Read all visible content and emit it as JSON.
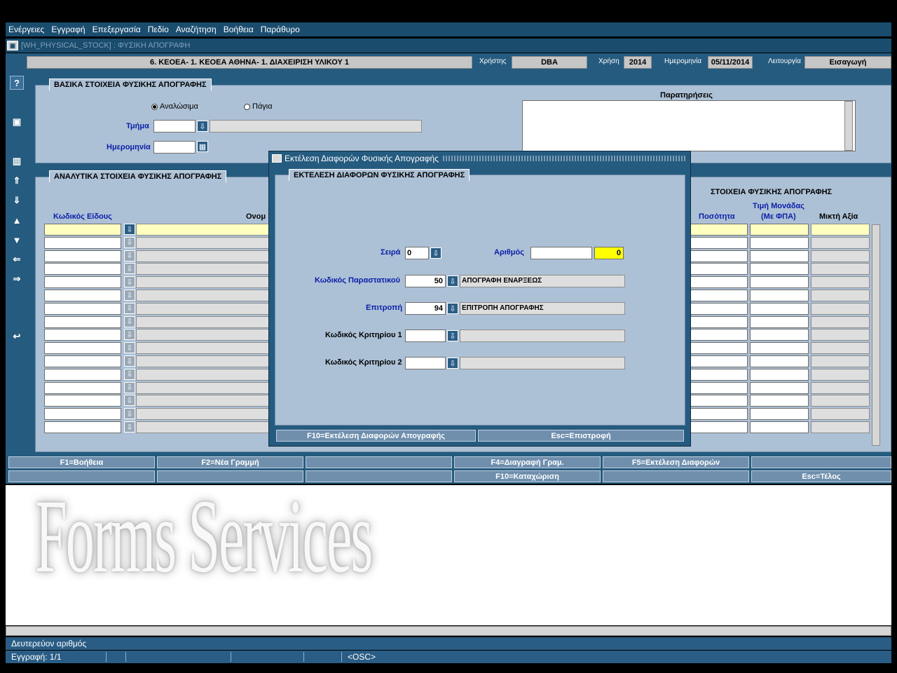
{
  "menu": [
    "Ενέργειες",
    "Εγγραφή",
    "Επεξεργασία",
    "Πεδίο",
    "Αναζήτηση",
    "Βοήθεια",
    "Παράθυρο"
  ],
  "window_title": "[WH_PHYSICAL_STOCK] : ΦΥΣΙΚΗ ΑΠΟΓΡΑΦΗ",
  "infobar": {
    "org": "6. ΚΕΟΕΑ- 1. ΚΕΟΕΑ ΑΘΗΝΑ- 1. ΔΙΑΧΕΙΡΙΣΗ ΥΛΙΚΟΥ 1",
    "user_label": "Χρήστης",
    "user": "DBA",
    "year_label": "Χρήση",
    "year": "2014",
    "date_label": "Ημερομηνία",
    "date": "05/11/2014",
    "mode_label": "Λειτουργία",
    "mode": "Εισαγωγή"
  },
  "basic": {
    "title": "ΒΑΣΙΚΑ ΣΤΟΙΧΕΙΑ ΦΥΣΙΚΗΣ ΑΠΟΓΡΑΦΗΣ",
    "radio1": "Αναλώσιμα",
    "radio2": "Πάγια",
    "dept_label": "Τμήμα",
    "date_label": "Ημερομηνία",
    "remarks_label": "Παρατηρήσεις"
  },
  "detail": {
    "title": "ΑΝΑΛΥΤΙΚΑ ΣΤΟΙΧΕΙΑ ΦΥΣΙΚΗΣ ΑΠΟΓΡΑΦΗΣ",
    "col_code": "Κωδικός Είδους",
    "col_name": "Ονομ",
    "group_title": "ΣΤΟΙΧΕΙΑ ΦΥΣΙΚΗΣ ΑΠΟΓΡΑΦΗΣ",
    "col_qty": "Ποσότητα",
    "col_price_line1": "Τιμή Μονάδας",
    "col_price_line2": "(Με ΦΠΑ)",
    "col_gross": "Μικτή Αξία"
  },
  "dialog": {
    "title": "Εκτέλεση Διαφορών Φυσικής Απογραφής",
    "panel_title": "ΕΚΤΕΛΕΣΗ ΔΙΑΦΟΡΩΝ ΦΥΣΙΚΗΣ ΑΠΟΓΡΑΦΗΣ",
    "series_label": "Σειρά",
    "series_value": "0",
    "number_label": "Αριθμός",
    "number_value": "0",
    "doc_label": "Κωδικός Παραστατικού",
    "doc_code": "50",
    "doc_name": "ΑΠΟΓΡΑΦΗ ΕΝΑΡΞΕΩΣ",
    "committee_label": "Επιτροπή",
    "committee_code": "94",
    "committee_name": "ΕΠΙΤΡΟΠΗ ΑΠΟΓΡΑΦΗΣ",
    "crit1_label": "Κωδικός Κριτηρίου 1",
    "crit2_label": "Κωδικός Κριτηρίου 2",
    "btn_run": "F10=Εκτέλεση Διαφορών Απογραφής",
    "btn_back": "Esc=Επιστροφή"
  },
  "fkeys_row1": [
    "F1=Βοήθεια",
    "F2=Νέα Γραμμή",
    "",
    "F4=Διαγραφή Γραμ.",
    "F5=Εκτέλεση Διαφορών",
    ""
  ],
  "fkeys_row2": [
    "",
    "",
    "",
    "F10=Καταχώριση",
    "",
    "Esc=Τέλος"
  ],
  "watermark": "Forms Services",
  "status": {
    "hint": "Δευτερεύον αριθμός",
    "record": "Εγγραφή: 1/1",
    "osc": "<OSC>"
  }
}
